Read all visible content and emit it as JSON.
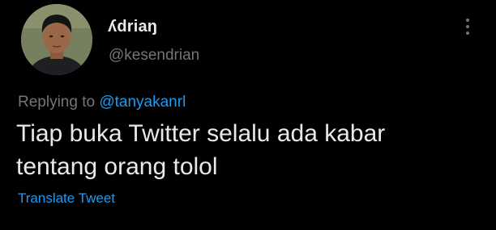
{
  "user": {
    "display_name": "ʎdriaŋ",
    "handle": "@kesendrian",
    "avatar_icon": "profile-photo"
  },
  "reply": {
    "prefix": "Replying to ",
    "mention": "@tanyakanrl"
  },
  "tweet": {
    "line1": "Tiap buka Twitter selalu ada kabar",
    "line2": "tentang orang tolol"
  },
  "actions": {
    "translate_label": "Translate Tweet",
    "more_icon": "more-vertical-icon"
  },
  "colors": {
    "background": "#000000",
    "text": "#e7e9ea",
    "muted": "#71767b",
    "accent": "#1d9bf0"
  }
}
